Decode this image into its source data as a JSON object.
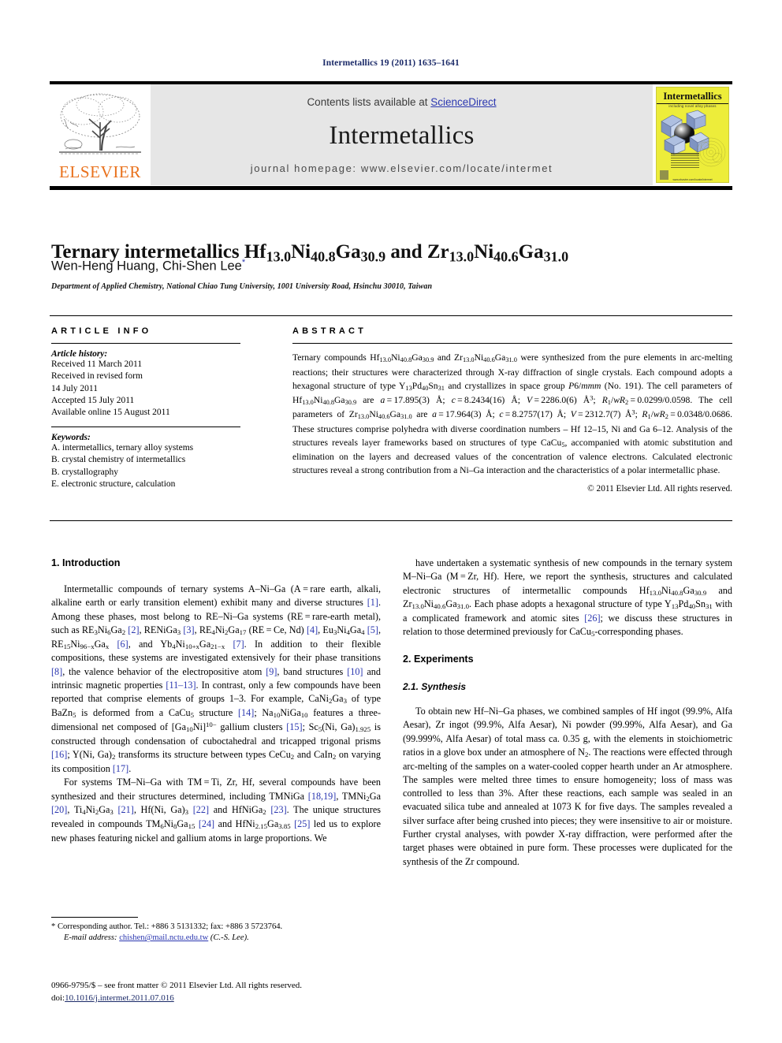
{
  "running_head": "Intermetallics 19 (2011) 1635–1641",
  "masthead": {
    "contents_prefix": "Contents lists available at ",
    "sciencedirect": "ScienceDirect",
    "journal_name": "Intermetallics",
    "homepage": "journal homepage: www.elsevier.com/locate/intermet",
    "publisher_logo_text": "ELSEVIER",
    "cover": {
      "title": "Intermetallics",
      "subtitle": "including novel alloy phases",
      "footer": "www.elsevier.com/locate/intermet"
    },
    "link_color": "#2b37b0",
    "band_color": "#e6e6e6",
    "cover_color": "#eded3a",
    "elsevier_orange": "#E9711C"
  },
  "article": {
    "title_html": "Ternary intermetallics Hf<sub>13.0</sub>Ni<sub>40.8</sub>Ga<sub>30.9</sub> and Zr<sub>13.0</sub>Ni<sub>40.6</sub>Ga<sub>31.0</sub>",
    "authors": "Wen-Heng Huang, Chi-Shen Lee",
    "corresponding_marker": "*",
    "affiliation": "Department of Applied Chemistry, National Chiao Tung University, 1001 University Road, Hsinchu 30010, Taiwan"
  },
  "info": {
    "heading": "ARTICLE INFO",
    "history_label": "Article history:",
    "history": [
      "Received 11 March 2011",
      "Received in revised form",
      "14 July 2011",
      "Accepted 15 July 2011",
      "Available online 15 August 2011"
    ],
    "keywords_label": "Keywords:",
    "keywords": [
      "A. intermetallics, ternary alloy systems",
      "B. crystal chemistry of intermetallics",
      "B. crystallography",
      "E. electronic structure, calculation"
    ]
  },
  "abstract": {
    "heading": "ABSTRACT",
    "body_html": "Ternary compounds Hf<sub>13.0</sub>Ni<sub>40.8</sub>Ga<sub>30.9</sub> and Zr<sub>13.0</sub>Ni<sub>40.6</sub>Ga<sub>31.0</sub> were synthesized from the pure elements in arc-melting reactions; their structures were characterized through X-ray diffraction of single crystals. Each compound adopts a hexagonal structure of type Y<sub>13</sub>Pd<sub>40</sub>Sn<sub>31</sub> and crystallizes in space group <i>P</i>6/<i>mmm</i> (No. 191). The cell parameters of Hf<sub>13.0</sub>Ni<sub>40.8</sub>Ga<sub>30.9</sub> are <i>a</i>&#8201;=&#8201;17.895(3) Å; <i>c</i>&#8201;=&#8201;8.2434(16) Å; <i>V</i>&#8201;=&#8201;2286.0(6) Å<sup>3</sup>; <i>R</i><sub>1</sub>/<i>wR</i><sub>2</sub>&#8201;=&#8201;0.0299/0.0598. The cell parameters of Zr<sub>13.0</sub>Ni<sub>40.6</sub>Ga<sub>31.0</sub> are <i>a</i>&#8201;=&#8201;17.964(3) Å; <i>c</i>&#8201;=&#8201;8.2757(17) Å; <i>V</i>&#8201;=&#8201;2312.7(7) Å<sup>3</sup>; <i>R</i><sub>1</sub>/<i>wR</i><sub>2</sub>&#8201;=&#8201;0.0348/0.0686. These structures comprise polyhedra with diverse coordination numbers – Hf 12–15, Ni and Ga 6–12. Analysis of the structures reveals layer frameworks based on structures of type CaCu<sub>5</sub>, accompanied with atomic substitution and elimination on the layers and decreased values of the concentration of valence electrons. Calculated electronic structures reveal a strong contribution from a Ni–Ga interaction and the characteristics of a polar intermetallic phase.",
    "copyright": "© 2011 Elsevier Ltd. All rights reserved."
  },
  "sections": {
    "introduction_heading": "1. Introduction",
    "intro_p1_html": "Intermetallic compounds of ternary systems A–Ni–Ga (A = rare earth, alkali, alkaline earth or early transition element) exhibit many and diverse structures <span class=\"ref\">[1]</span>. Among these phases, most belong to RE–Ni–Ga systems (RE = rare-earth metal), such as RE<sub>3</sub>Ni<sub>6</sub>Ga<sub>2</sub> <span class=\"ref\">[2]</span>, RENiGa<sub>3</sub> <span class=\"ref\">[3]</span>, RE<sub>4</sub>Ni<sub>2</sub>Ga<sub>17</sub> (RE = Ce, Nd) <span class=\"ref\">[4]</span>, Eu<sub>3</sub>Ni<sub>4</sub>Ga<sub>4</sub> <span class=\"ref\">[5]</span>, RE<sub>15</sub>Ni<sub>96−x</sub>Ga<sub>x</sub> <span class=\"ref\">[6]</span>, and Yb<sub>4</sub>Ni<sub>10+x</sub>Ga<sub>21−x</sub> <span class=\"ref\">[7]</span>. In addition to their flexible compositions, these systems are investigated extensively for their phase transitions <span class=\"ref\">[8]</span>, the valence behavior of the electropositive atom <span class=\"ref\">[9]</span>, band structures <span class=\"ref\">[10]</span> and intrinsic magnetic properties <span class=\"ref\">[11–13]</span>. In contrast, only a few compounds have been reported that comprise elements of groups 1–3. For example, CaNi<sub>2</sub>Ga<sub>3</sub> of type BaZn<sub>5</sub> is deformed from a CaCu<sub>5</sub> structure <span class=\"ref\">[14]</span>; Na<sub>10</sub>NiGa<sub>10</sub> features a three-dimensional net composed of [Ga<sub>10</sub>Ni]<sup>10−</sup> gallium clusters <span class=\"ref\">[15]</span>; Sc<sub>5</sub>(Ni, Ga)<sub>1.925</sub> is constructed through condensation of cuboctahedral and tricapped trigonal prisms <span class=\"ref\">[16]</span>; Y(Ni, Ga)<sub>2</sub> transforms its structure between types CeCu<sub>2</sub> and CaIn<sub>2</sub> on varying its composition <span class=\"ref\">[17]</span>.",
    "intro_p2_html": "For systems TM–Ni–Ga with TM = Ti, Zr, Hf, several compounds have been synthesized and their structures determined, including TMNiGa <span class=\"ref\">[18,19]</span>, TMNi<sub>2</sub>Ga <span class=\"ref\">[20]</span>, Ti<sub>4</sub>Ni<sub>2</sub>Ga<sub>3</sub> <span class=\"ref\">[21]</span>, Hf(Ni, Ga)<sub>3</sub> <span class=\"ref\">[22]</span> and HfNiGa<sub>2</sub> <span class=\"ref\">[23]</span>. The unique structures revealed in compounds TM<sub>6</sub>Ni<sub>8</sub>Ga<sub>15</sub> <span class=\"ref\">[24]</span> and HfNi<sub>2.15</sub>Ga<sub>3.85</sub> <span class=\"ref\">[25]</span> led us to explore new phases featuring nickel and gallium atoms in large proportions. We",
    "intro_p3_html": "have undertaken a systematic synthesis of new compounds in the ternary system M–Ni–Ga (M = Zr, Hf). Here, we report the synthesis, structures and calculated electronic structures of intermetallic compounds Hf<sub>13.0</sub>Ni<sub>40.8</sub>Ga<sub>30.9</sub> and Zr<sub>13.0</sub>Ni<sub>40.6</sub>Ga<sub>31.0</sub>. Each phase adopts a hexagonal structure of type Y<sub>13</sub>Pd<sub>40</sub>Sn<sub>31</sub> with a complicated framework and atomic sites <span class=\"ref\">[26]</span>; we discuss these structures in relation to those determined previously for CaCu<sub>5</sub>-corresponding phases.",
    "experiments_heading": "2. Experiments",
    "synthesis_heading": "2.1. Synthesis",
    "synthesis_p_html": "To obtain new Hf–Ni–Ga phases, we combined samples of Hf ingot (99.9%, Alfa Aesar), Zr ingot (99.9%, Alfa Aesar), Ni powder (99.99%, Alfa Aesar), and Ga (99.999%, Alfa Aesar) of total mass ca. 0.35 g, with the elements in stoichiometric ratios in a glove box under an atmosphere of N<sub>2</sub>. The reactions were effected through arc-melting of the samples on a water-cooled copper hearth under an Ar atmosphere. The samples were melted three times to ensure homogeneity; loss of mass was controlled to less than 3%. After these reactions, each sample was sealed in an evacuated silica tube and annealed at 1073 K for five days. The samples revealed a silver surface after being crushed into pieces; they were insensitive to air or moisture. Further crystal analyses, with powder X-ray diffraction, were performed after the target phases were obtained in pure form. These processes were duplicated for the synthesis of the Zr compound."
  },
  "footnote": {
    "corresponding_html": "* Corresponding author. Tel.: +886 3 5131332; fax: +886 3 5723764.",
    "email_label": "E-mail address:",
    "email": "chishen@mail.nctu.edu.tw",
    "email_suffix": "(C.-S. Lee)."
  },
  "footer": {
    "issn_line": "0966-9795/$ – see front matter © 2011 Elsevier Ltd. All rights reserved.",
    "doi_prefix": "doi:",
    "doi": "10.1016/j.intermet.2011.07.016"
  }
}
